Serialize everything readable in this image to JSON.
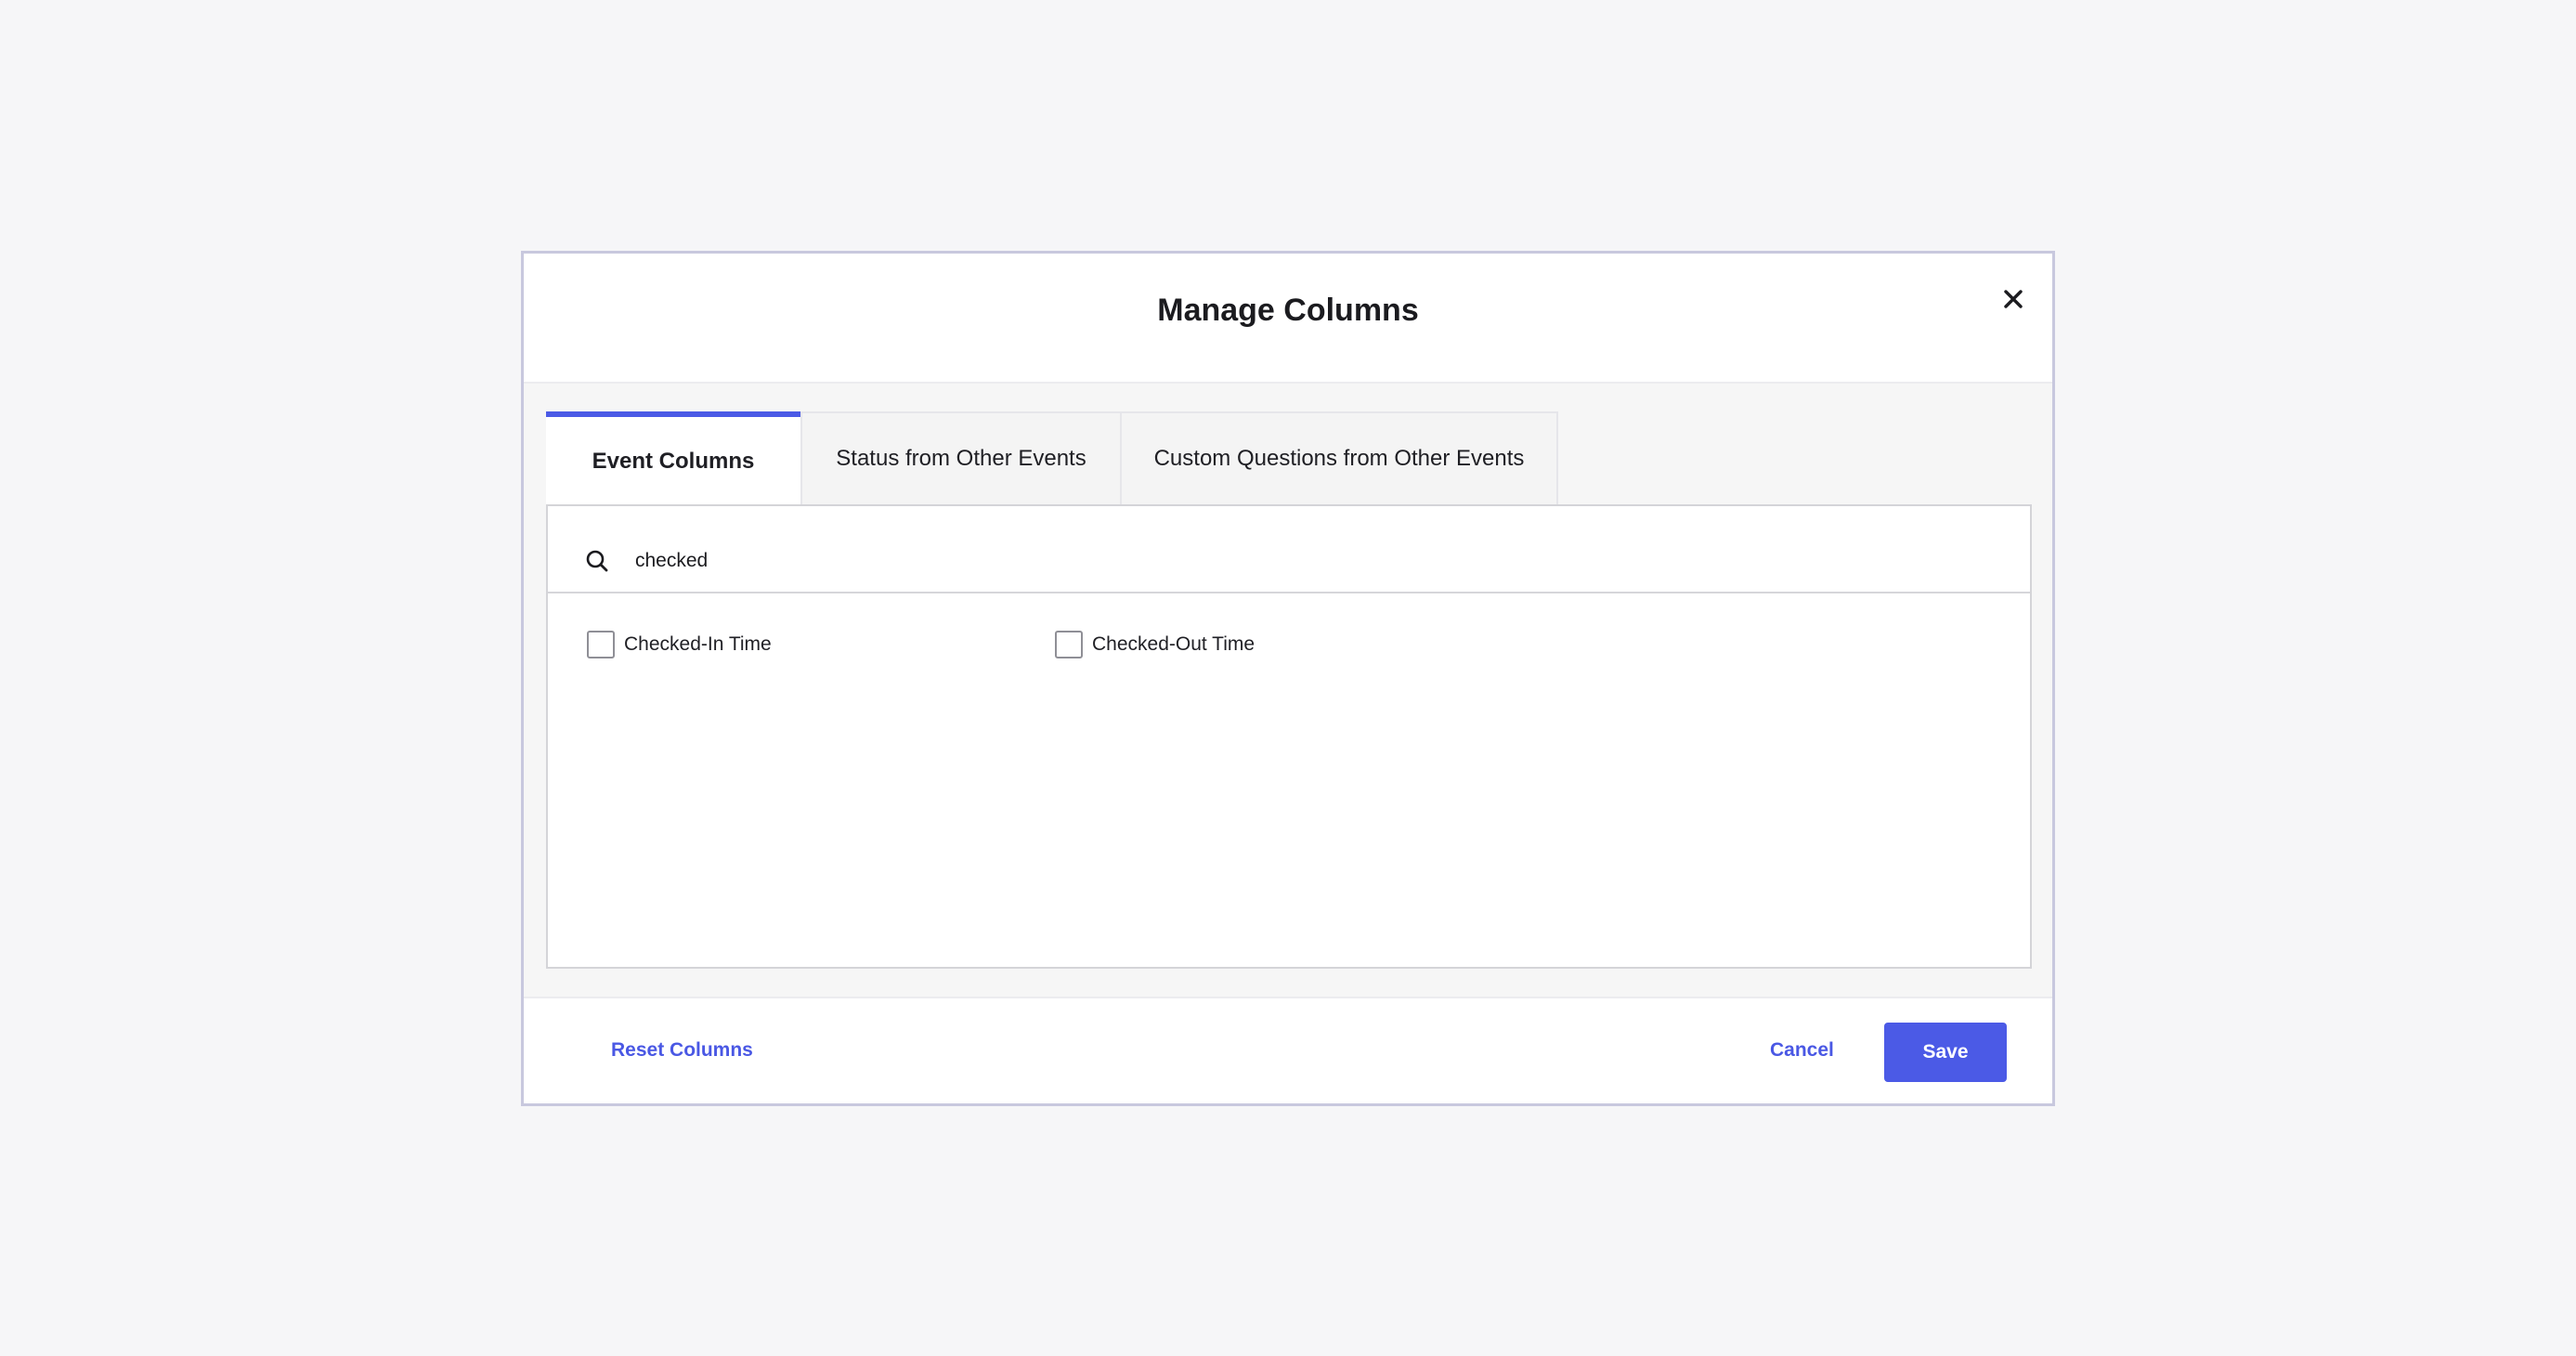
{
  "modal": {
    "title": "Manage Columns"
  },
  "tabs": [
    {
      "label": "Event Columns",
      "active": true
    },
    {
      "label": "Status from Other Events",
      "active": false
    },
    {
      "label": "Custom Questions from Other Events",
      "active": false
    }
  ],
  "search": {
    "value": "checked",
    "icon": "search-icon"
  },
  "options": [
    {
      "label": "Checked-In Time",
      "checked": false
    },
    {
      "label": "Checked-Out Time",
      "checked": false
    }
  ],
  "footer": {
    "reset_label": "Reset Columns",
    "cancel_label": "Cancel",
    "save_label": "Save"
  },
  "colors": {
    "accent": "#4b5ae6",
    "background": "#f6f6f8"
  }
}
